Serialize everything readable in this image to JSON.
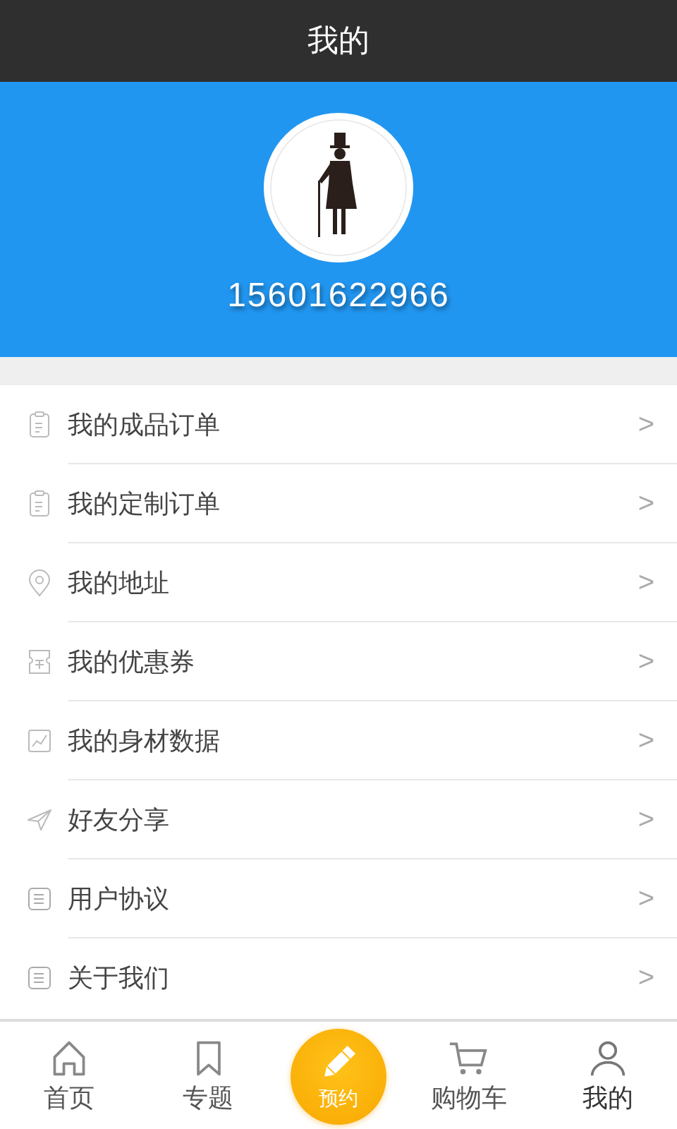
{
  "header": {
    "title": "我的"
  },
  "profile": {
    "phone": "15601622966"
  },
  "menu": [
    {
      "label": "我的成品订单",
      "chevron": ">"
    },
    {
      "label": "我的定制订单",
      "chevron": ">"
    },
    {
      "label": "我的地址",
      "chevron": ">"
    },
    {
      "label": "我的优惠券",
      "chevron": ">"
    },
    {
      "label": "我的身材数据",
      "chevron": ">"
    },
    {
      "label": "好友分享",
      "chevron": ">"
    },
    {
      "label": "用户协议",
      "chevron": ">"
    },
    {
      "label": "关于我们",
      "chevron": ">"
    }
  ],
  "tabbar": [
    {
      "kind": "tab",
      "label": "首页",
      "selected": false
    },
    {
      "kind": "tab",
      "label": "专题",
      "selected": false
    },
    {
      "kind": "center",
      "label": "预约",
      "selected": false
    },
    {
      "kind": "tab",
      "label": "购物车",
      "selected": false
    },
    {
      "kind": "tab",
      "label": "我的",
      "selected": true
    }
  ]
}
